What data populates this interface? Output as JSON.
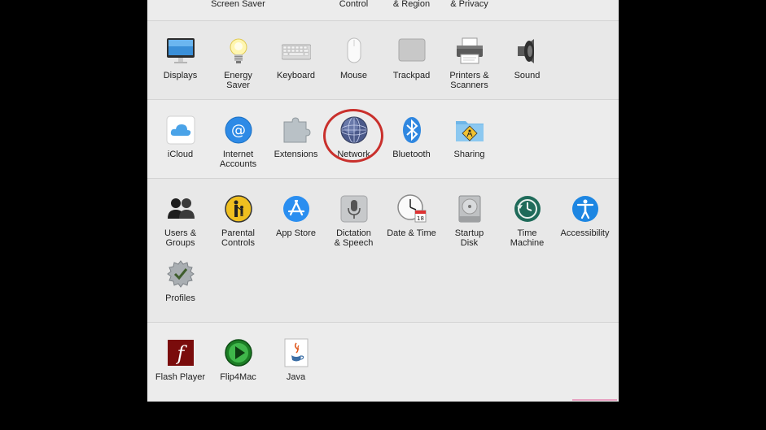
{
  "top_row_partial": [
    "Screen Saver",
    "Control",
    "& Region",
    "& Privacy"
  ],
  "hardware": [
    {
      "label": "Displays",
      "icon": "displays-icon"
    },
    {
      "label": "Energy\nSaver",
      "icon": "light-bulb-icon"
    },
    {
      "label": "Keyboard",
      "icon": "keyboard-icon"
    },
    {
      "label": "Mouse",
      "icon": "mouse-icon"
    },
    {
      "label": "Trackpad",
      "icon": "trackpad-icon"
    },
    {
      "label": "Printers &\nScanners",
      "icon": "printer-icon"
    },
    {
      "label": "Sound",
      "icon": "speaker-icon"
    }
  ],
  "internet": [
    {
      "label": "iCloud",
      "icon": "icloud-icon"
    },
    {
      "label": "Internet\nAccounts",
      "icon": "at-sign-icon"
    },
    {
      "label": "Extensions",
      "icon": "puzzle-icon"
    },
    {
      "label": "Network",
      "icon": "globe-icon"
    },
    {
      "label": "Bluetooth",
      "icon": "bluetooth-icon"
    },
    {
      "label": "Sharing",
      "icon": "sharing-folder-icon"
    }
  ],
  "system": [
    {
      "label": "Users &\nGroups",
      "icon": "users-icon"
    },
    {
      "label": "Parental\nControls",
      "icon": "parental-controls-icon"
    },
    {
      "label": "App Store",
      "icon": "app-store-icon"
    },
    {
      "label": "Dictation\n& Speech",
      "icon": "microphone-icon"
    },
    {
      "label": "Date & Time",
      "icon": "clock-calendar-icon"
    },
    {
      "label": "Startup\nDisk",
      "icon": "hard-disk-icon"
    },
    {
      "label": "Time\nMachine",
      "icon": "time-machine-icon"
    },
    {
      "label": "Accessibility",
      "icon": "accessibility-icon"
    },
    {
      "label": "Profiles",
      "icon": "profiles-badge-icon"
    }
  ],
  "other": [
    {
      "label": "Flash Player",
      "icon": "flash-icon"
    },
    {
      "label": "Flip4Mac",
      "icon": "flip4mac-icon"
    },
    {
      "label": "Java",
      "icon": "java-icon"
    }
  ],
  "highlighted_pane": "Network",
  "colors": {
    "highlight": "#c9302c",
    "panel": "#ececec",
    "backdrop": "#000000"
  }
}
